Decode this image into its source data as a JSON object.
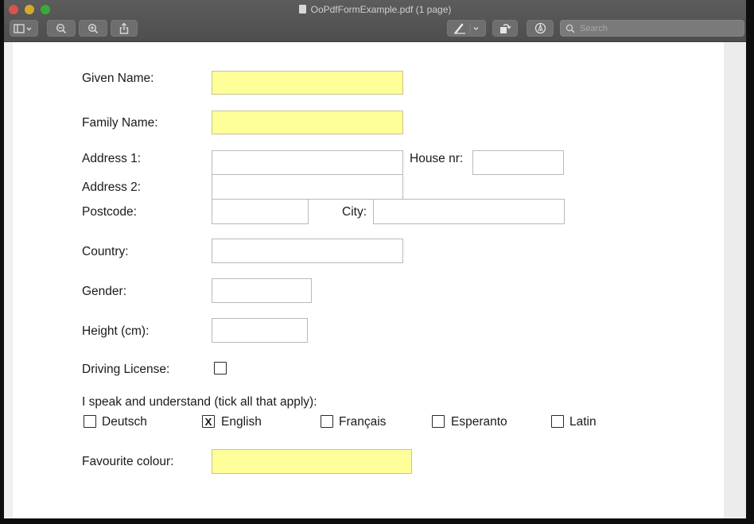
{
  "window": {
    "title": "OoPdfFormExample.pdf (1 page)",
    "search_placeholder": "Search"
  },
  "toolbar": {
    "icons": [
      "sidebar-icon",
      "zoom-out-icon",
      "zoom-in-icon",
      "share-icon",
      "markup-pen-icon",
      "rotate-icon",
      "annotate-icon",
      "search-icon"
    ]
  },
  "colors": {
    "required_field": "#ffff99",
    "titlebar": "#555555",
    "close": "#d9534f",
    "minimize": "#d4ab2c",
    "maximize": "#3aa93a"
  },
  "form": {
    "given_name": {
      "label": "Given Name:",
      "value": ""
    },
    "family_name": {
      "label": "Family Name:",
      "value": ""
    },
    "address1": {
      "label": "Address 1:",
      "value": ""
    },
    "house_nr": {
      "label": "House nr:",
      "value": ""
    },
    "address2": {
      "label": "Address 2:",
      "value": ""
    },
    "postcode": {
      "label": "Postcode:",
      "value": ""
    },
    "city": {
      "label": "City:",
      "value": ""
    },
    "country": {
      "label": "Country:",
      "value": ""
    },
    "gender": {
      "label": "Gender:",
      "value": ""
    },
    "height": {
      "label": "Height (cm):",
      "value": ""
    },
    "driving_license": {
      "label": "Driving License:",
      "checked": false,
      "mark": ""
    },
    "languages_label": "I speak and understand (tick all that apply):",
    "languages": [
      {
        "label": "Deutsch",
        "checked": false,
        "mark": ""
      },
      {
        "label": "English",
        "checked": true,
        "mark": "X"
      },
      {
        "label": "Français",
        "checked": false,
        "mark": ""
      },
      {
        "label": "Esperanto",
        "checked": false,
        "mark": ""
      },
      {
        "label": "Latin",
        "checked": false,
        "mark": ""
      }
    ],
    "favourite_colour": {
      "label": "Favourite colour:",
      "value": ""
    }
  }
}
